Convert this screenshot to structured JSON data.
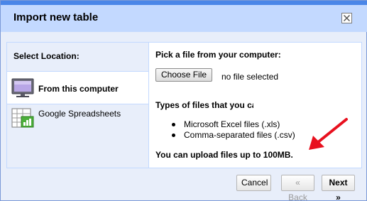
{
  "dialog": {
    "title": "Import new table",
    "close_icon": "close-icon"
  },
  "sidebar": {
    "title": "Select Location:",
    "items": [
      {
        "label": "From this computer",
        "icon": "computer-monitor-icon",
        "active": true
      },
      {
        "label": "Google Spreadsheets",
        "icon": "spreadsheet-icon",
        "active": false
      }
    ]
  },
  "content": {
    "pick_label": "Pick a file from your computer:",
    "choose_button": "Choose File",
    "file_status": "no file selected",
    "types_label": "Types of files that you can upload:",
    "file_types": [
      "Microsoft Excel files (.xls)",
      "Comma-separated files (.csv)"
    ],
    "limit_label": "You can upload files up to 100MB."
  },
  "annotation": {
    "arrow_color": "#e8101e",
    "arrow_icon": "red-arrow-icon"
  },
  "footer": {
    "cancel": "Cancel",
    "back": "« Back",
    "next": "Next »"
  },
  "colors": {
    "topbar": "#4a86e8",
    "header": "#c3d9ff",
    "panel": "#e8eefa"
  }
}
